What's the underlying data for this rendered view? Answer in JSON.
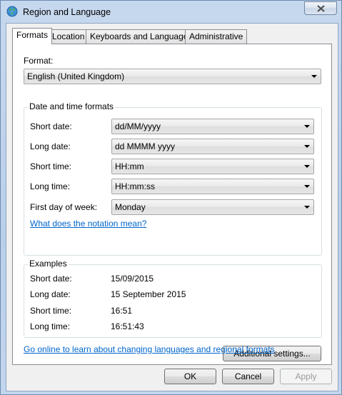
{
  "window": {
    "title": "Region and Language"
  },
  "tabs": [
    {
      "label": "Formats"
    },
    {
      "label": "Location"
    },
    {
      "label": "Keyboards and Languages"
    },
    {
      "label": "Administrative"
    }
  ],
  "format": {
    "label": "Format:",
    "value": "English (United Kingdom)"
  },
  "date_time_group": {
    "title": "Date and time formats",
    "rows": [
      {
        "label": "Short date:",
        "value": "dd/MM/yyyy"
      },
      {
        "label": "Long date:",
        "value": "dd MMMM yyyy"
      },
      {
        "label": "Short time:",
        "value": "HH:mm"
      },
      {
        "label": "Long time:",
        "value": "HH:mm:ss"
      },
      {
        "label": "First day of week:",
        "value": "Monday"
      }
    ],
    "notation_link": "What does the notation mean?"
  },
  "examples": {
    "title": "Examples",
    "rows": [
      {
        "label": "Short date:",
        "value": "15/09/2015"
      },
      {
        "label": "Long date:",
        "value": "15 September 2015"
      },
      {
        "label": "Short time:",
        "value": "16:51"
      },
      {
        "label": "Long time:",
        "value": "16:51:43"
      }
    ]
  },
  "additional_settings_label": "Additional settings...",
  "online_link": "Go online to learn about changing languages and regional formats",
  "buttons": {
    "ok": "OK",
    "cancel": "Cancel",
    "apply": "Apply"
  }
}
